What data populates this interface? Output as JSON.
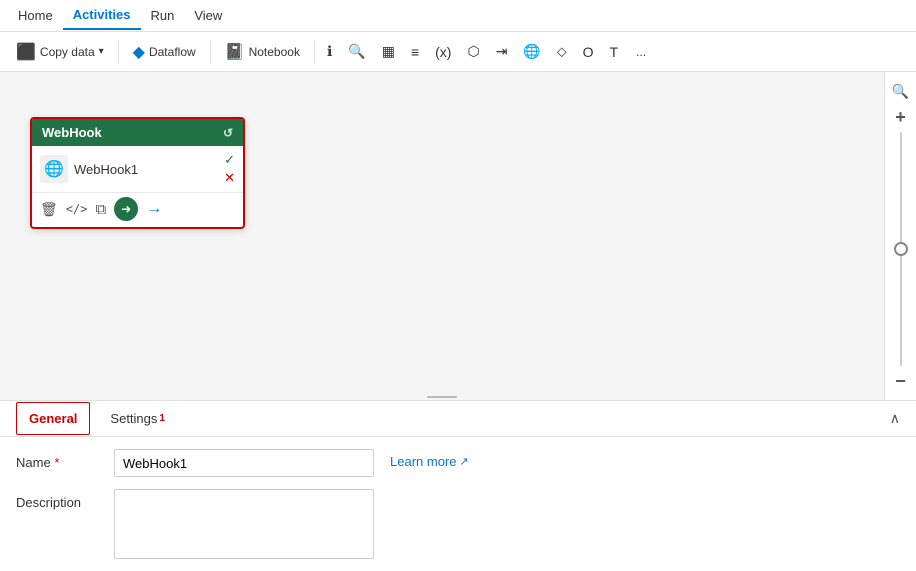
{
  "nav": {
    "items": [
      {
        "id": "home",
        "label": "Home",
        "active": false
      },
      {
        "id": "activities",
        "label": "Activities",
        "active": true
      },
      {
        "id": "run",
        "label": "Run",
        "active": false
      },
      {
        "id": "view",
        "label": "View",
        "active": false
      }
    ]
  },
  "toolbar": {
    "copy_data_label": "Copy data",
    "dataflow_label": "Dataflow",
    "notebook_label": "Notebook",
    "more_label": "..."
  },
  "webhook": {
    "title": "WebHook",
    "name": "WebHook1"
  },
  "panel": {
    "tabs": [
      {
        "id": "general",
        "label": "General",
        "active": true,
        "badge": ""
      },
      {
        "id": "settings",
        "label": "Settings",
        "active": false,
        "badge": "1"
      }
    ],
    "form": {
      "name_label": "Name",
      "name_required": "*",
      "name_value": "WebHook1",
      "description_label": "Description",
      "description_value": "",
      "learn_more_label": "Learn more"
    }
  },
  "icons": {
    "search": "🔍",
    "plus": "+",
    "minus": "−",
    "chevron_up": "∧",
    "copy_data_icon": "⬛",
    "dataflow_icon": "⬛",
    "notebook_icon": "⬛",
    "refresh": "↺",
    "check": "✓",
    "x": "✕",
    "delete": "🗑",
    "code": "</>",
    "copy": "⧉",
    "arrow_right_circle": "➡",
    "arrow_right": "→",
    "globe": "🌐",
    "external_link": "↗"
  }
}
